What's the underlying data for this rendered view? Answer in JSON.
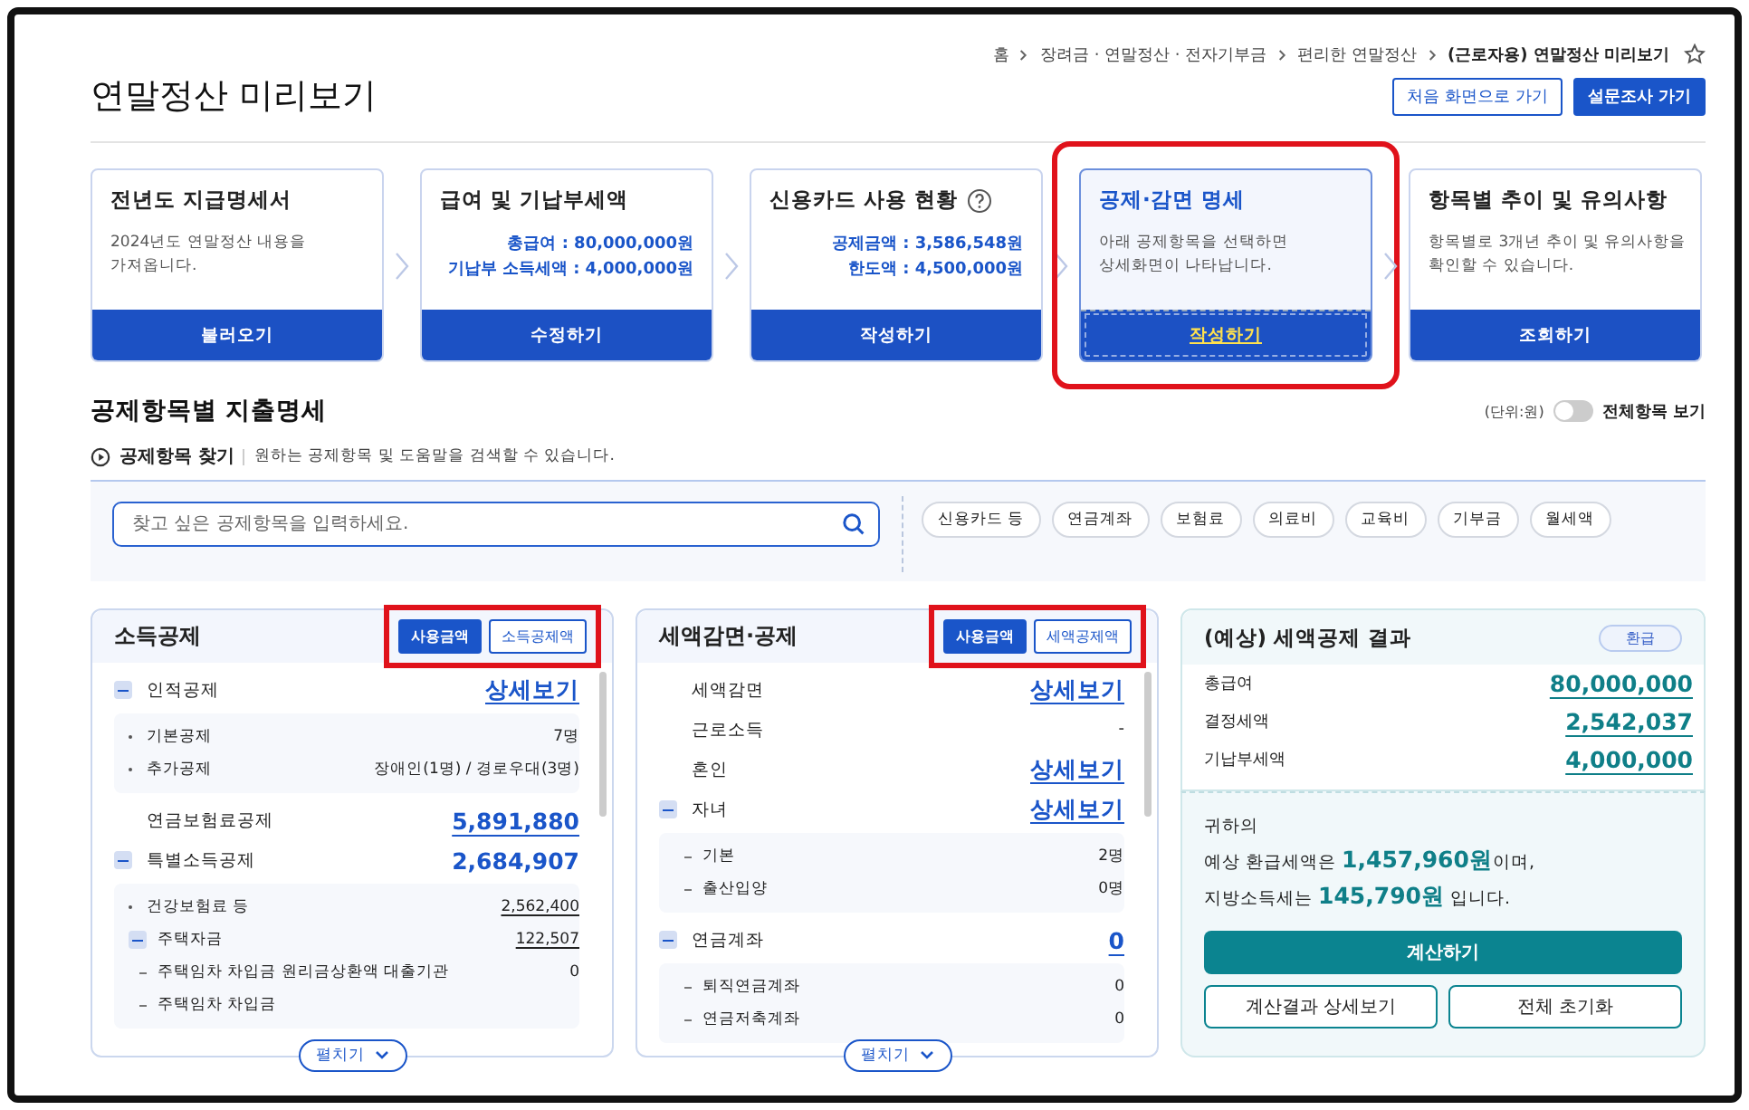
{
  "breadcrumb": [
    "홈",
    "장려금 · 연말정산 · 전자기부금",
    "편리한 연말정산",
    "(근로자용) 연말정산 미리보기"
  ],
  "page": {
    "title": "연말정산 미리보기",
    "buttons": [
      {
        "label": "처음 화면으로 가기",
        "kind": "outline"
      },
      {
        "label": "설문조사 가기",
        "kind": "primary"
      }
    ]
  },
  "steps": [
    {
      "title": "전년도 지급명세서",
      "help": false,
      "kind": "note",
      "lines": [
        "2024년도 연말정산 내용을",
        "가져옵니다."
      ],
      "button": "불러오기",
      "selected": false,
      "highlighted": false
    },
    {
      "title": "급여 및 기납부세액",
      "help": false,
      "kind": "amounts",
      "lines": [
        "총급여 : 80,000,000원",
        "기납부 소득세액 : 4,000,000원"
      ],
      "button": "수정하기",
      "selected": false,
      "highlighted": false
    },
    {
      "title": "신용카드 사용 현황",
      "help": true,
      "kind": "amounts",
      "lines": [
        "공제금액 : 3,586,548원",
        "한도액 : 4,500,000원"
      ],
      "button": "작성하기",
      "selected": false,
      "highlighted": false
    },
    {
      "title": "공제·감면 명세",
      "help": false,
      "kind": "note",
      "lines": [
        "아래 공제항목을 선택하면",
        "상세화면이 나타납니다."
      ],
      "button": "작성하기",
      "selected": true,
      "highlighted": true
    },
    {
      "title": "항목별 추이 및 유의사항",
      "help": false,
      "kind": "note",
      "lines": [
        "항목별로 3개년 추이 및 유의사항을",
        "확인할 수 있습니다."
      ],
      "button": "조회하기",
      "selected": false,
      "highlighted": false
    }
  ],
  "section": {
    "title": "공제항목별 지출명세",
    "unit": "(단위:원)",
    "show_all": {
      "label": "전체항목 보기",
      "on": false
    },
    "finder_label": "공제항목 찾기",
    "finder_hint": "원하는 공제항목 및 도움말을 검색할 수 있습니다.",
    "search": {
      "placeholder": "찾고 싶은 공제항목을 입력하세요."
    },
    "chips": [
      "신용카드 등",
      "연금계좌",
      "보험료",
      "의료비",
      "교육비",
      "기부금",
      "월세액"
    ]
  },
  "panels": [
    {
      "title": "소득공제",
      "highlighted": true,
      "toggles": [
        {
          "label": "사용금액",
          "selected": true
        },
        {
          "label": "소득공제액",
          "selected": false
        }
      ],
      "expand": "펼치기",
      "rows": [
        {
          "kind": "group",
          "label": "인적공제",
          "value": "상세보기",
          "link": true,
          "expanded": true,
          "children": [
            {
              "kind": "dot",
              "label": "기본공제",
              "value": "7명",
              "link": false
            },
            {
              "kind": "dot",
              "label": "추가공제",
              "value": "장애인(1명) / 경로우대(3명)",
              "link": false
            }
          ]
        },
        {
          "kind": "plain",
          "label": "연금보험료공제",
          "value": "5,891,880",
          "link": true
        },
        {
          "kind": "group",
          "label": "특별소득공제",
          "value": "2,684,907",
          "link": false,
          "expanded": true,
          "children": [
            {
              "kind": "dot",
              "label": "건강보험료 등",
              "value": "2,562,400",
              "link": true
            },
            {
              "kind": "subgroup",
              "label": "주택자금",
              "value": "122,507",
              "link": true,
              "expanded": true
            },
            {
              "kind": "dash",
              "label": "주택임차 차입금 원리금상환액 대출기관",
              "value": "0",
              "link": false
            },
            {
              "kind": "dash",
              "label": "주택임차 차입금"
            }
          ]
        }
      ]
    },
    {
      "title": "세액감면·공제",
      "highlighted": true,
      "toggles": [
        {
          "label": "사용금액",
          "selected": true
        },
        {
          "label": "세액공제액",
          "selected": false
        }
      ],
      "expand": "펼치기",
      "rows": [
        {
          "kind": "plain",
          "label": "세액감면",
          "value": "상세보기",
          "link": true
        },
        {
          "kind": "plain",
          "label": "근로소득",
          "value": "-",
          "link": false
        },
        {
          "kind": "plain",
          "label": "혼인",
          "value": "상세보기",
          "link": true
        },
        {
          "kind": "group",
          "label": "자녀",
          "value": "상세보기",
          "link": true,
          "expanded": true,
          "children": [
            {
              "kind": "dash",
              "label": "기본",
              "value": "2명",
              "link": false
            },
            {
              "kind": "dash",
              "label": "출산입양",
              "value": "0명",
              "link": false
            }
          ]
        },
        {
          "kind": "group",
          "label": "연금계좌",
          "value": "0",
          "link": true,
          "expanded": true,
          "children": [
            {
              "kind": "dash",
              "label": "퇴직연금계좌",
              "value": "0",
              "link": false
            },
            {
              "kind": "dash",
              "label": "연금저축계좌",
              "value": "0",
              "link": false
            }
          ]
        }
      ]
    }
  ],
  "result": {
    "title": "(예상) 세액공제 결과",
    "badge": "환급",
    "rows": [
      {
        "label": "총급여",
        "value": "80,000,000"
      },
      {
        "label": "결정세액",
        "value": "2,542,037"
      },
      {
        "label": "기납부세액",
        "value": "4,000,000"
      }
    ],
    "message": [
      "귀하의",
      "예상 환급세액은 **1,457,960원**이며,",
      "지방소득세는 **145,790원** 입니다."
    ],
    "buttons": [
      {
        "label": "계산하기",
        "kind": "primary"
      },
      {
        "label": "계산결과 상세보기",
        "kind": "outline"
      },
      {
        "label": "전체 초기화",
        "kind": "outline"
      }
    ]
  }
}
